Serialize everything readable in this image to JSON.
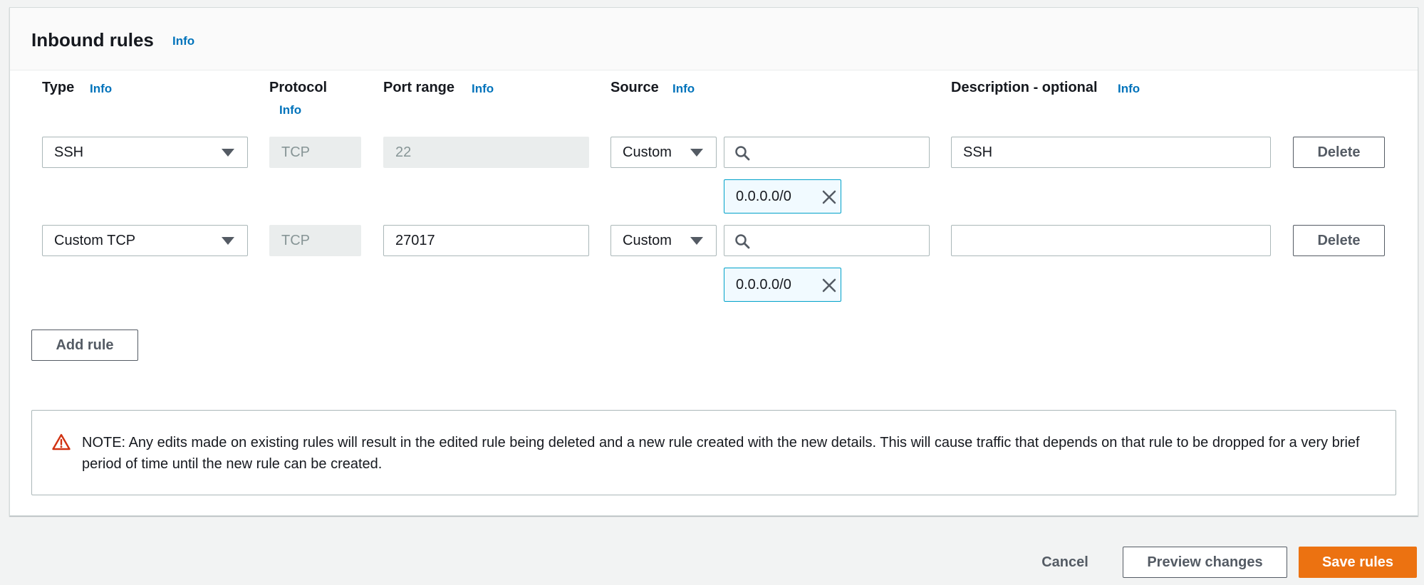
{
  "panel": {
    "title": "Inbound rules",
    "info": "Info"
  },
  "columns": {
    "type": {
      "label": "Type",
      "info": "Info"
    },
    "protocol": {
      "label": "Protocol",
      "info": "Info"
    },
    "port_range": {
      "label": "Port range",
      "info": "Info"
    },
    "source": {
      "label": "Source",
      "info": "Info"
    },
    "description": {
      "label": "Description - optional",
      "info": "Info"
    }
  },
  "rules": [
    {
      "type": "SSH",
      "protocol": "TCP",
      "port_range": "22",
      "port_disabled": true,
      "source_type": "Custom",
      "source_search": "",
      "cidr": "0.0.0.0/0",
      "description": "SSH",
      "delete": "Delete"
    },
    {
      "type": "Custom TCP",
      "protocol": "TCP",
      "port_range": "27017",
      "port_disabled": false,
      "source_type": "Custom",
      "source_search": "",
      "cidr": "0.0.0.0/0",
      "description": "",
      "delete": "Delete"
    }
  ],
  "add_rule": "Add rule",
  "note": "NOTE: Any edits made on existing rules will result in the edited rule being deleted and a new rule created with the new details. This will cause traffic that depends on that rule to be dropped for a very brief period of time until the new rule can be created.",
  "footer": {
    "cancel": "Cancel",
    "preview": "Preview changes",
    "save": "Save rules"
  },
  "icons": {
    "dropdown": "caret-down-icon",
    "search": "search-icon",
    "remove": "close-icon",
    "warning": "warning-icon"
  },
  "colors": {
    "accent": "#ec7211",
    "link": "#0073bb",
    "token_border": "#00a1c9",
    "warning": "#d13212"
  }
}
